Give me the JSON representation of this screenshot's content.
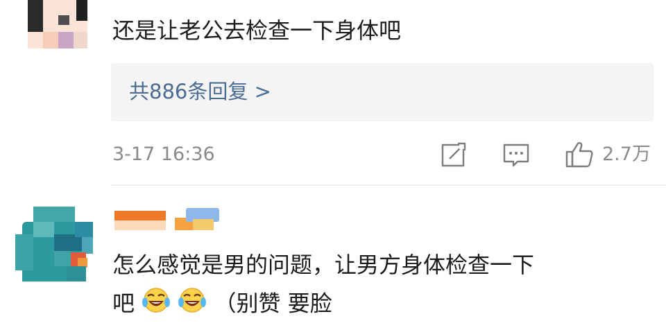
{
  "comment1": {
    "text": "还是让老公去检查一下身体吧",
    "replies_link": "共886条回复 >",
    "timestamp": "3-17 16:36",
    "like_count": "2.7万",
    "actions": [
      "share-icon",
      "comment-icon",
      "like-icon"
    ]
  },
  "comment2": {
    "text_line1": "怎么感觉是男的问题，让男方身体检查一下",
    "text_line2_start": "吧",
    "emojis": [
      "laugh-cry-emoji",
      "laugh-cry-emoji"
    ],
    "text_line2_end": "（别赞  要脸"
  },
  "colors": {
    "link": "#4a6b94",
    "meta": "#8a8a8a",
    "reply_bg": "#f4f4f4"
  }
}
